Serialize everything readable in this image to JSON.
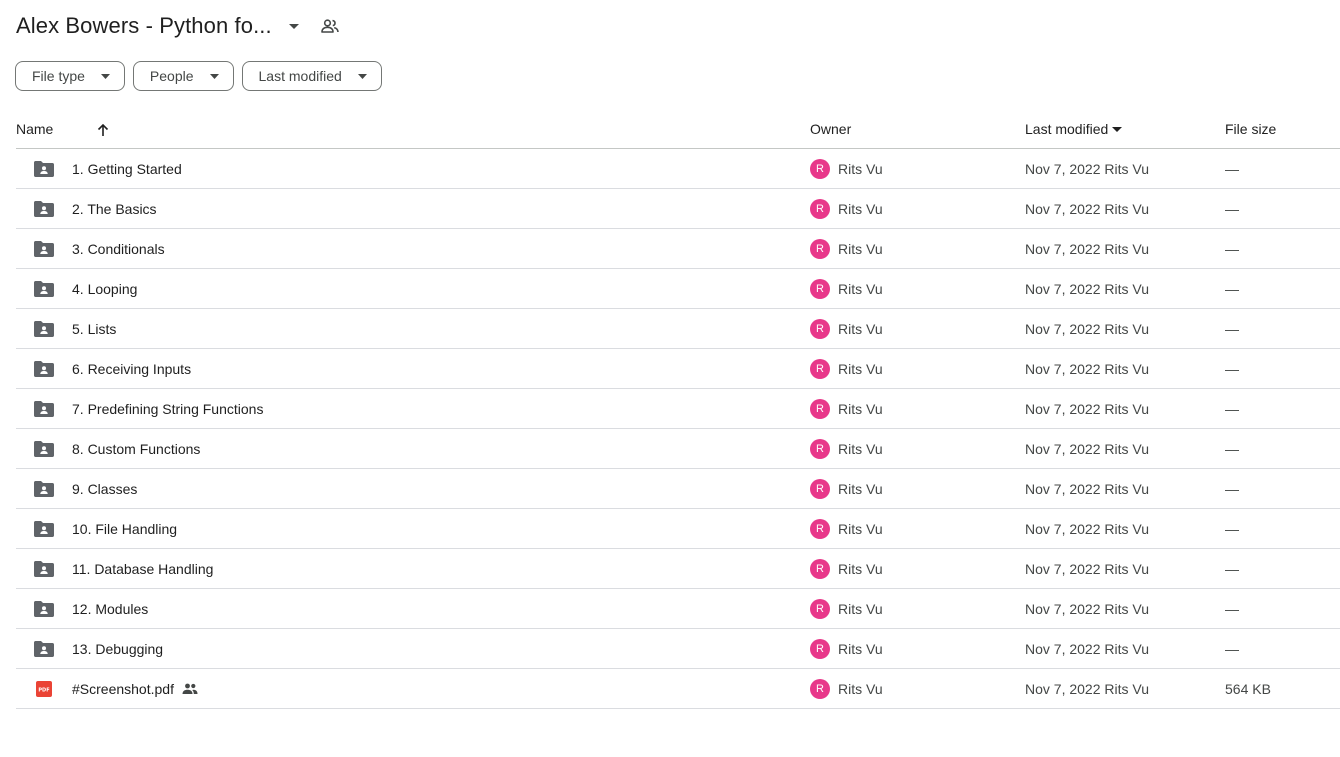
{
  "header": {
    "title": "Alex Bowers - Python fo..."
  },
  "filters": [
    {
      "label": "File type"
    },
    {
      "label": "People"
    },
    {
      "label": "Last modified"
    }
  ],
  "columns": {
    "name": "Name",
    "owner": "Owner",
    "last_modified": "Last modified",
    "file_size": "File size"
  },
  "files": [
    {
      "name": "1. Getting Started",
      "type": "shared-folder-icon",
      "owner": "Rits Vu",
      "owner_initial": "R",
      "modified": "Nov 7, 2022",
      "modified_by": "Rits Vu",
      "size": "—"
    },
    {
      "name": "2. The Basics",
      "type": "shared-folder-icon",
      "owner": "Rits Vu",
      "owner_initial": "R",
      "modified": "Nov 7, 2022",
      "modified_by": "Rits Vu",
      "size": "—"
    },
    {
      "name": "3. Conditionals",
      "type": "shared-folder-icon",
      "owner": "Rits Vu",
      "owner_initial": "R",
      "modified": "Nov 7, 2022",
      "modified_by": "Rits Vu",
      "size": "—"
    },
    {
      "name": "4. Looping",
      "type": "shared-folder-icon",
      "owner": "Rits Vu",
      "owner_initial": "R",
      "modified": "Nov 7, 2022",
      "modified_by": "Rits Vu",
      "size": "—"
    },
    {
      "name": "5. Lists",
      "type": "shared-folder-icon",
      "owner": "Rits Vu",
      "owner_initial": "R",
      "modified": "Nov 7, 2022",
      "modified_by": "Rits Vu",
      "size": "—"
    },
    {
      "name": "6. Receiving Inputs",
      "type": "shared-folder-icon",
      "owner": "Rits Vu",
      "owner_initial": "R",
      "modified": "Nov 7, 2022",
      "modified_by": "Rits Vu",
      "size": "—"
    },
    {
      "name": "7. Predefining String Functions",
      "type": "shared-folder-icon",
      "owner": "Rits Vu",
      "owner_initial": "R",
      "modified": "Nov 7, 2022",
      "modified_by": "Rits Vu",
      "size": "—"
    },
    {
      "name": "8. Custom Functions",
      "type": "shared-folder-icon",
      "owner": "Rits Vu",
      "owner_initial": "R",
      "modified": "Nov 7, 2022",
      "modified_by": "Rits Vu",
      "size": "—"
    },
    {
      "name": "9. Classes",
      "type": "shared-folder-icon",
      "owner": "Rits Vu",
      "owner_initial": "R",
      "modified": "Nov 7, 2022",
      "modified_by": "Rits Vu",
      "size": "—"
    },
    {
      "name": "10. File Handling",
      "type": "shared-folder-icon",
      "owner": "Rits Vu",
      "owner_initial": "R",
      "modified": "Nov 7, 2022",
      "modified_by": "Rits Vu",
      "size": "—"
    },
    {
      "name": "11. Database Handling",
      "type": "shared-folder-icon",
      "owner": "Rits Vu",
      "owner_initial": "R",
      "modified": "Nov 7, 2022",
      "modified_by": "Rits Vu",
      "size": "—"
    },
    {
      "name": "12. Modules",
      "type": "shared-folder-icon",
      "owner": "Rits Vu",
      "owner_initial": "R",
      "modified": "Nov 7, 2022",
      "modified_by": "Rits Vu",
      "size": "—"
    },
    {
      "name": "13. Debugging",
      "type": "shared-folder-icon",
      "owner": "Rits Vu",
      "owner_initial": "R",
      "modified": "Nov 7, 2022",
      "modified_by": "Rits Vu",
      "size": "—"
    },
    {
      "name": "#Screenshot.pdf",
      "type": "pdf-icon",
      "shared": true,
      "owner": "Rits Vu",
      "owner_initial": "R",
      "modified": "Nov 7, 2022",
      "modified_by": "Rits Vu",
      "size": "564 KB"
    }
  ],
  "colors": {
    "avatar": "#e8388a",
    "folder": "#5f6368",
    "pdf": "#ea4335"
  }
}
